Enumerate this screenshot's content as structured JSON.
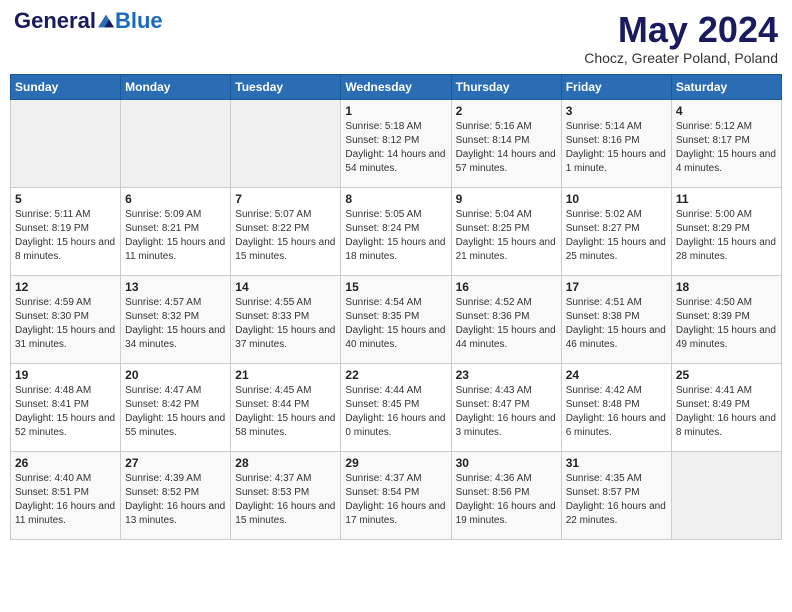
{
  "header": {
    "logo_general": "General",
    "logo_blue": "Blue",
    "month_title": "May 2024",
    "location": "Chocz, Greater Poland, Poland"
  },
  "days_of_week": [
    "Sunday",
    "Monday",
    "Tuesday",
    "Wednesday",
    "Thursday",
    "Friday",
    "Saturday"
  ],
  "weeks": [
    [
      {
        "num": "",
        "sunrise": "",
        "sunset": "",
        "daylight": ""
      },
      {
        "num": "",
        "sunrise": "",
        "sunset": "",
        "daylight": ""
      },
      {
        "num": "",
        "sunrise": "",
        "sunset": "",
        "daylight": ""
      },
      {
        "num": "1",
        "sunrise": "Sunrise: 5:18 AM",
        "sunset": "Sunset: 8:12 PM",
        "daylight": "Daylight: 14 hours and 54 minutes."
      },
      {
        "num": "2",
        "sunrise": "Sunrise: 5:16 AM",
        "sunset": "Sunset: 8:14 PM",
        "daylight": "Daylight: 14 hours and 57 minutes."
      },
      {
        "num": "3",
        "sunrise": "Sunrise: 5:14 AM",
        "sunset": "Sunset: 8:16 PM",
        "daylight": "Daylight: 15 hours and 1 minute."
      },
      {
        "num": "4",
        "sunrise": "Sunrise: 5:12 AM",
        "sunset": "Sunset: 8:17 PM",
        "daylight": "Daylight: 15 hours and 4 minutes."
      }
    ],
    [
      {
        "num": "5",
        "sunrise": "Sunrise: 5:11 AM",
        "sunset": "Sunset: 8:19 PM",
        "daylight": "Daylight: 15 hours and 8 minutes."
      },
      {
        "num": "6",
        "sunrise": "Sunrise: 5:09 AM",
        "sunset": "Sunset: 8:21 PM",
        "daylight": "Daylight: 15 hours and 11 minutes."
      },
      {
        "num": "7",
        "sunrise": "Sunrise: 5:07 AM",
        "sunset": "Sunset: 8:22 PM",
        "daylight": "Daylight: 15 hours and 15 minutes."
      },
      {
        "num": "8",
        "sunrise": "Sunrise: 5:05 AM",
        "sunset": "Sunset: 8:24 PM",
        "daylight": "Daylight: 15 hours and 18 minutes."
      },
      {
        "num": "9",
        "sunrise": "Sunrise: 5:04 AM",
        "sunset": "Sunset: 8:25 PM",
        "daylight": "Daylight: 15 hours and 21 minutes."
      },
      {
        "num": "10",
        "sunrise": "Sunrise: 5:02 AM",
        "sunset": "Sunset: 8:27 PM",
        "daylight": "Daylight: 15 hours and 25 minutes."
      },
      {
        "num": "11",
        "sunrise": "Sunrise: 5:00 AM",
        "sunset": "Sunset: 8:29 PM",
        "daylight": "Daylight: 15 hours and 28 minutes."
      }
    ],
    [
      {
        "num": "12",
        "sunrise": "Sunrise: 4:59 AM",
        "sunset": "Sunset: 8:30 PM",
        "daylight": "Daylight: 15 hours and 31 minutes."
      },
      {
        "num": "13",
        "sunrise": "Sunrise: 4:57 AM",
        "sunset": "Sunset: 8:32 PM",
        "daylight": "Daylight: 15 hours and 34 minutes."
      },
      {
        "num": "14",
        "sunrise": "Sunrise: 4:55 AM",
        "sunset": "Sunset: 8:33 PM",
        "daylight": "Daylight: 15 hours and 37 minutes."
      },
      {
        "num": "15",
        "sunrise": "Sunrise: 4:54 AM",
        "sunset": "Sunset: 8:35 PM",
        "daylight": "Daylight: 15 hours and 40 minutes."
      },
      {
        "num": "16",
        "sunrise": "Sunrise: 4:52 AM",
        "sunset": "Sunset: 8:36 PM",
        "daylight": "Daylight: 15 hours and 44 minutes."
      },
      {
        "num": "17",
        "sunrise": "Sunrise: 4:51 AM",
        "sunset": "Sunset: 8:38 PM",
        "daylight": "Daylight: 15 hours and 46 minutes."
      },
      {
        "num": "18",
        "sunrise": "Sunrise: 4:50 AM",
        "sunset": "Sunset: 8:39 PM",
        "daylight": "Daylight: 15 hours and 49 minutes."
      }
    ],
    [
      {
        "num": "19",
        "sunrise": "Sunrise: 4:48 AM",
        "sunset": "Sunset: 8:41 PM",
        "daylight": "Daylight: 15 hours and 52 minutes."
      },
      {
        "num": "20",
        "sunrise": "Sunrise: 4:47 AM",
        "sunset": "Sunset: 8:42 PM",
        "daylight": "Daylight: 15 hours and 55 minutes."
      },
      {
        "num": "21",
        "sunrise": "Sunrise: 4:45 AM",
        "sunset": "Sunset: 8:44 PM",
        "daylight": "Daylight: 15 hours and 58 minutes."
      },
      {
        "num": "22",
        "sunrise": "Sunrise: 4:44 AM",
        "sunset": "Sunset: 8:45 PM",
        "daylight": "Daylight: 16 hours and 0 minutes."
      },
      {
        "num": "23",
        "sunrise": "Sunrise: 4:43 AM",
        "sunset": "Sunset: 8:47 PM",
        "daylight": "Daylight: 16 hours and 3 minutes."
      },
      {
        "num": "24",
        "sunrise": "Sunrise: 4:42 AM",
        "sunset": "Sunset: 8:48 PM",
        "daylight": "Daylight: 16 hours and 6 minutes."
      },
      {
        "num": "25",
        "sunrise": "Sunrise: 4:41 AM",
        "sunset": "Sunset: 8:49 PM",
        "daylight": "Daylight: 16 hours and 8 minutes."
      }
    ],
    [
      {
        "num": "26",
        "sunrise": "Sunrise: 4:40 AM",
        "sunset": "Sunset: 8:51 PM",
        "daylight": "Daylight: 16 hours and 11 minutes."
      },
      {
        "num": "27",
        "sunrise": "Sunrise: 4:39 AM",
        "sunset": "Sunset: 8:52 PM",
        "daylight": "Daylight: 16 hours and 13 minutes."
      },
      {
        "num": "28",
        "sunrise": "Sunrise: 4:37 AM",
        "sunset": "Sunset: 8:53 PM",
        "daylight": "Daylight: 16 hours and 15 minutes."
      },
      {
        "num": "29",
        "sunrise": "Sunrise: 4:37 AM",
        "sunset": "Sunset: 8:54 PM",
        "daylight": "Daylight: 16 hours and 17 minutes."
      },
      {
        "num": "30",
        "sunrise": "Sunrise: 4:36 AM",
        "sunset": "Sunset: 8:56 PM",
        "daylight": "Daylight: 16 hours and 19 minutes."
      },
      {
        "num": "31",
        "sunrise": "Sunrise: 4:35 AM",
        "sunset": "Sunset: 8:57 PM",
        "daylight": "Daylight: 16 hours and 22 minutes."
      },
      {
        "num": "",
        "sunrise": "",
        "sunset": "",
        "daylight": ""
      }
    ]
  ]
}
